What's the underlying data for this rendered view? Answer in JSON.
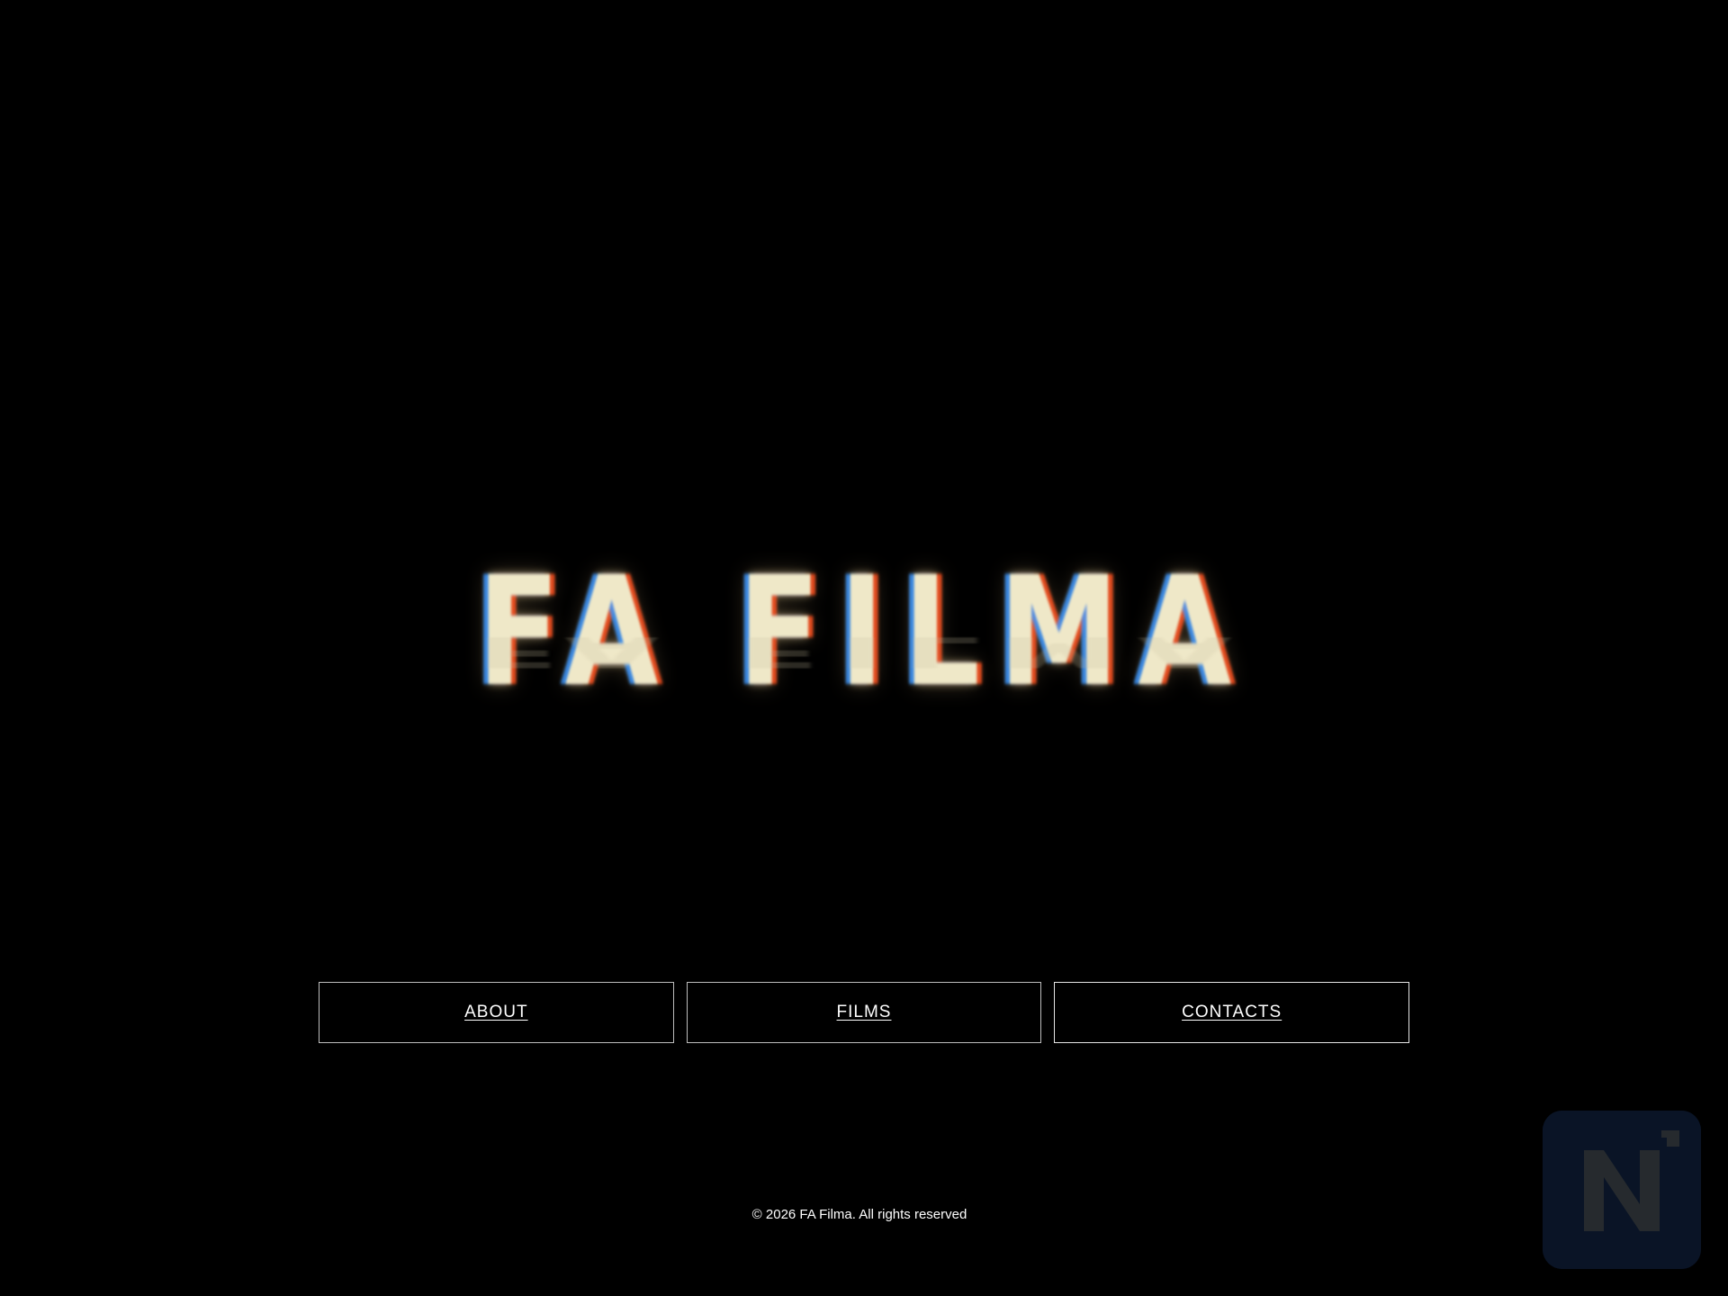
{
  "brand": {
    "logo_text": "FA FILMA"
  },
  "nav": {
    "items": [
      {
        "label": "ABOUT"
      },
      {
        "label": "FILMS"
      },
      {
        "label": "CONTACTS"
      }
    ]
  },
  "footer": {
    "copyright": "© 2026 FA Filma. All rights reserved"
  },
  "badge": {
    "icon": "n-logo-icon"
  },
  "colors": {
    "background": "#000000",
    "logo": "#efe8c8",
    "nav_border": "#bdbdbd",
    "text": "#ffffff",
    "badge_bg": "#0a1426"
  }
}
